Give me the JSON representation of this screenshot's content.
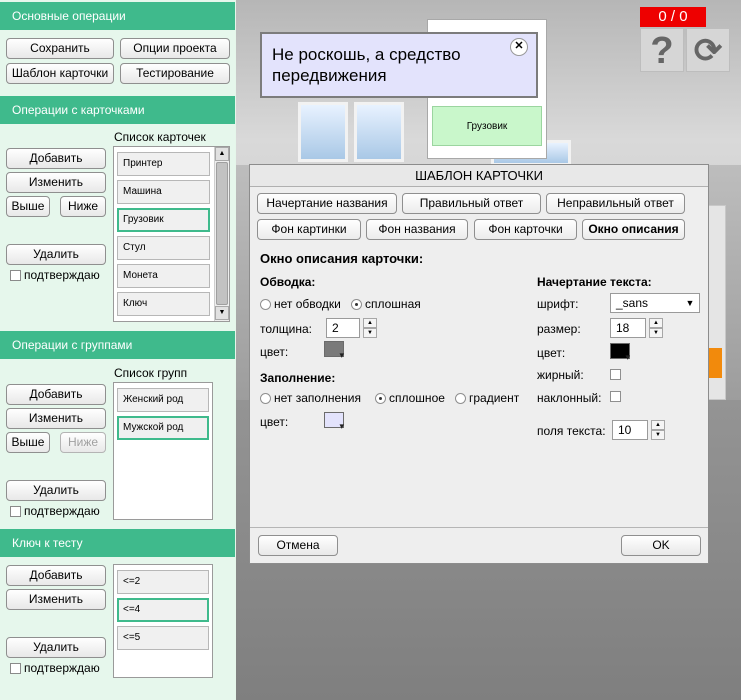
{
  "sections": {
    "basic_ops": "Основные операции",
    "card_ops": "Операции с карточками",
    "group_ops": "Операции с группами",
    "test_key": "Ключ к тесту"
  },
  "basic": {
    "save": "Сохранить",
    "project_options": "Опции проекта",
    "card_template": "Шаблон карточки",
    "testing": "Тестирование"
  },
  "cards": {
    "list_title": "Список карточек",
    "add": "Добавить",
    "edit": "Изменить",
    "up": "Выше",
    "down": "Ниже",
    "delete": "Удалить",
    "confirm": "подтверждаю",
    "items": [
      "Принтер",
      "Машина",
      "Грузовик",
      "Стул",
      "Монета",
      "Ключ"
    ]
  },
  "groups": {
    "list_title": "Список групп",
    "add": "Добавить",
    "edit": "Изменить",
    "up": "Выше",
    "down": "Ниже",
    "delete": "Удалить",
    "confirm": "подтверждаю",
    "items": [
      "Женский род",
      "Мужской род"
    ]
  },
  "key": {
    "add": "Добавить",
    "edit": "Изменить",
    "delete": "Удалить",
    "confirm": "подтверждаю",
    "items": [
      "<=2",
      "<=4",
      "<=5"
    ]
  },
  "stage": {
    "score": "0 / 0",
    "help_glyph": "?",
    "reset_glyph": "⟳",
    "card_text": "Грузовик",
    "hint_text": "Не роскошь, а средство передвижения",
    "hint_close": "✕"
  },
  "dialog": {
    "title": "ШАБЛОН КАРТОЧКИ",
    "tabs": [
      "Начертание названия",
      "Правильный ответ",
      "Неправильный ответ",
      "Фон картинки",
      "Фон названия",
      "Фон карточки",
      "Окно описания"
    ],
    "active_tab": "Окно описания",
    "heading": "Окно описания карточки:",
    "border": {
      "label": "Обводка:",
      "none": "нет обводки",
      "solid": "сплошная",
      "selected": "сплошная",
      "thickness_label": "толщина:",
      "thickness": "2",
      "color_label": "цвет:",
      "color": "#7a7a7a"
    },
    "fill": {
      "label": "Заполнение:",
      "none": "нет заполнения",
      "solid": "сплошное",
      "gradient": "градиент",
      "selected": "сплошное",
      "color_label": "цвет:",
      "color": "#e3e3fc"
    },
    "text": {
      "label": "Начертание текста:",
      "font_label": "шрифт:",
      "font": "_sans",
      "size_label": "размер:",
      "size": "18",
      "color_label": "цвет:",
      "color": "#000000",
      "bold_label": "жирный:",
      "bold": false,
      "italic_label": "наклонный:",
      "italic": false,
      "padding_label": "поля текста:",
      "padding": "10"
    },
    "cancel": "Отмена",
    "ok": "OK"
  },
  "colors": {
    "section_header": "#3fba8c",
    "panel_bg": "#e6f7ec",
    "score_bg": "#ee0000",
    "selected_item_border": "#3fba8c",
    "hint_bg": "#e3e3fc",
    "card_green": "#c9f7cb"
  }
}
